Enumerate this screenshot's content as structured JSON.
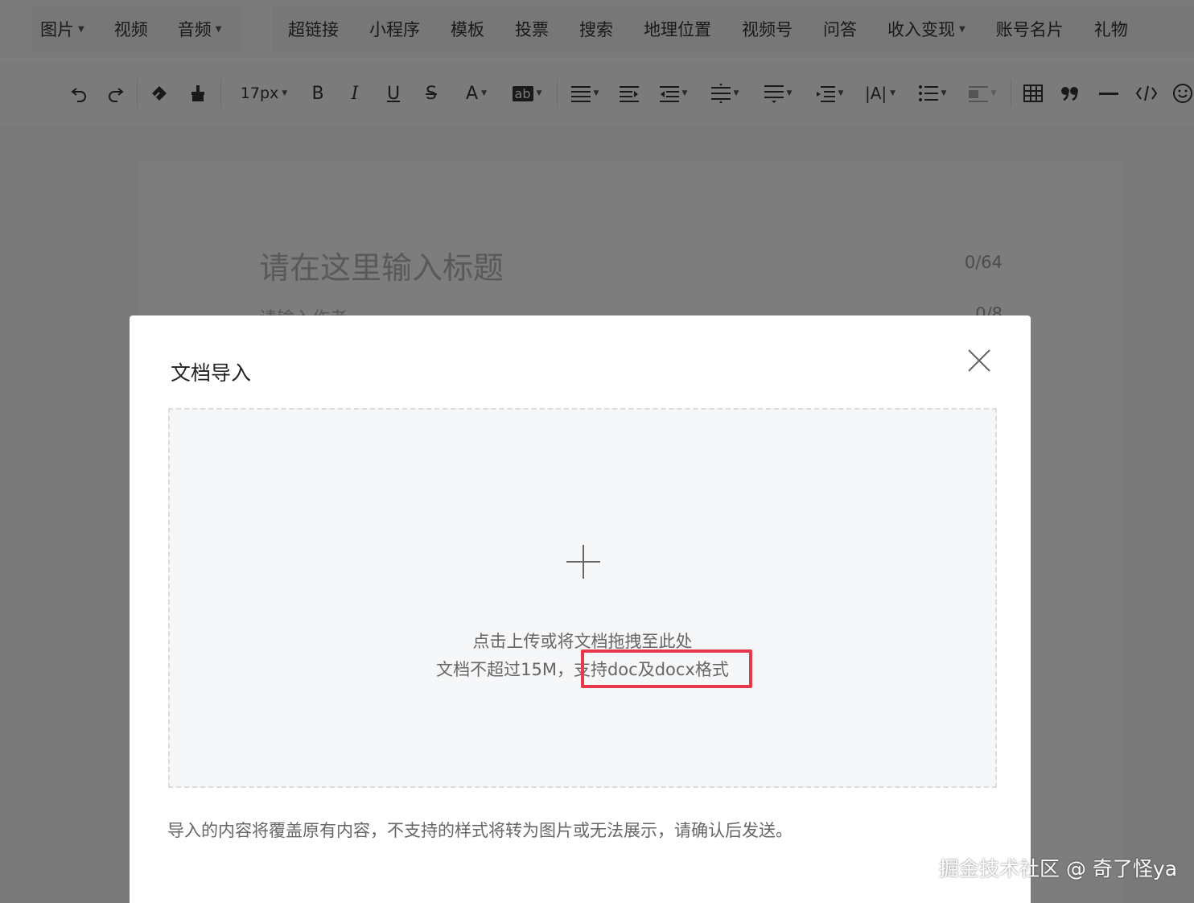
{
  "menu": {
    "group1": [
      {
        "label": "图片",
        "has_caret": true
      },
      {
        "label": "视频",
        "has_caret": false
      },
      {
        "label": "音频",
        "has_caret": true
      }
    ],
    "group2": [
      {
        "label": "超链接",
        "has_caret": false
      },
      {
        "label": "小程序",
        "has_caret": false
      },
      {
        "label": "模板",
        "has_caret": false
      },
      {
        "label": "投票",
        "has_caret": false
      },
      {
        "label": "搜索",
        "has_caret": false
      },
      {
        "label": "地理位置",
        "has_caret": false
      },
      {
        "label": "视频号",
        "has_caret": false
      },
      {
        "label": "问答",
        "has_caret": false
      },
      {
        "label": "收入变现",
        "has_caret": true
      },
      {
        "label": "账号名片",
        "has_caret": false
      },
      {
        "label": "礼物",
        "has_caret": false
      }
    ]
  },
  "toolbar": {
    "font_size": "17px",
    "bold": "B",
    "italic": "I",
    "underline": "U",
    "strikethrough": "S",
    "font_color": "A",
    "bg_color": "ab",
    "letter_spacing": "|A|"
  },
  "editor": {
    "title_placeholder": "请在这里输入标题",
    "title_count": "0/64",
    "author_placeholder": "请输入作者",
    "author_count": "0/8"
  },
  "modal": {
    "title": "文档导入",
    "dropzone_line1": "点击上传或将文档拖拽至此处",
    "dropzone_line2": "文档不超过15M，支持doc及docx格式",
    "note": "导入的内容将覆盖原有内容，不支持的样式将转为图片或无法展示，请确认后发送。"
  },
  "annotation": {
    "highlight_color": "#e8384b"
  },
  "watermark": "掘金技术社区 @ 奇了怪ya",
  "icons": [
    "undo-icon",
    "redo-icon",
    "clear-format-icon",
    "format-painter-icon",
    "align-icon",
    "indent-icon",
    "outdent-icon",
    "line-height-icon",
    "paragraph-spacing-icon",
    "list-icon",
    "table-icon",
    "quote-icon",
    "divider-icon",
    "code-icon",
    "emoji-icon",
    "close-icon",
    "plus-icon"
  ]
}
